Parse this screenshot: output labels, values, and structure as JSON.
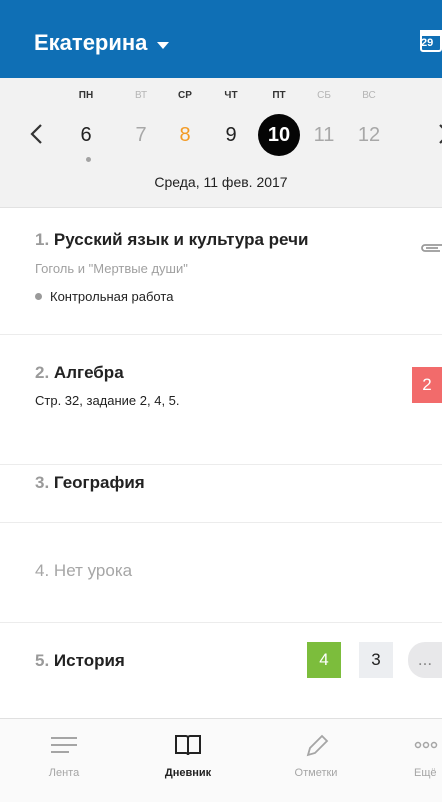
{
  "header": {
    "title": "Екатерина",
    "calendar_day": "29",
    "accent_color": "#0f6fb5"
  },
  "week": {
    "days": [
      {
        "dow": "ПН",
        "num": "6"
      },
      {
        "dow": "ВТ",
        "num": "7"
      },
      {
        "dow": "СР",
        "num": "8"
      },
      {
        "dow": "ЧТ",
        "num": "9"
      },
      {
        "dow": "ПТ",
        "num": "10"
      },
      {
        "dow": "СБ",
        "num": "11"
      },
      {
        "dow": "ВС",
        "num": "12"
      }
    ],
    "date_label": "Среда, 11 фев. 2017"
  },
  "lessons": [
    {
      "num": "1.",
      "title": "Русский язык и культура речи",
      "subtitle": "Гоголь и \"Мертвые души\"",
      "test": "Контрольная работа",
      "icon": "paperclip-icon"
    },
    {
      "num": "2.",
      "title": "Алгебра",
      "subtitle": "Стр. 32, задание 2, 4, 5.",
      "grades": [
        "2"
      ]
    },
    {
      "num": "3.",
      "title": "География"
    },
    {
      "num": "4.",
      "title": "Нет урока"
    },
    {
      "num": "5.",
      "title": "История",
      "grades": [
        "4",
        "3",
        "..."
      ]
    }
  ],
  "tabs": [
    {
      "label": "Лента",
      "icon": "feed-icon"
    },
    {
      "label": "Дневник",
      "icon": "book-icon"
    },
    {
      "label": "Отметки",
      "icon": "pencil-icon"
    },
    {
      "label": "Ещё",
      "icon": "more-icon"
    }
  ]
}
